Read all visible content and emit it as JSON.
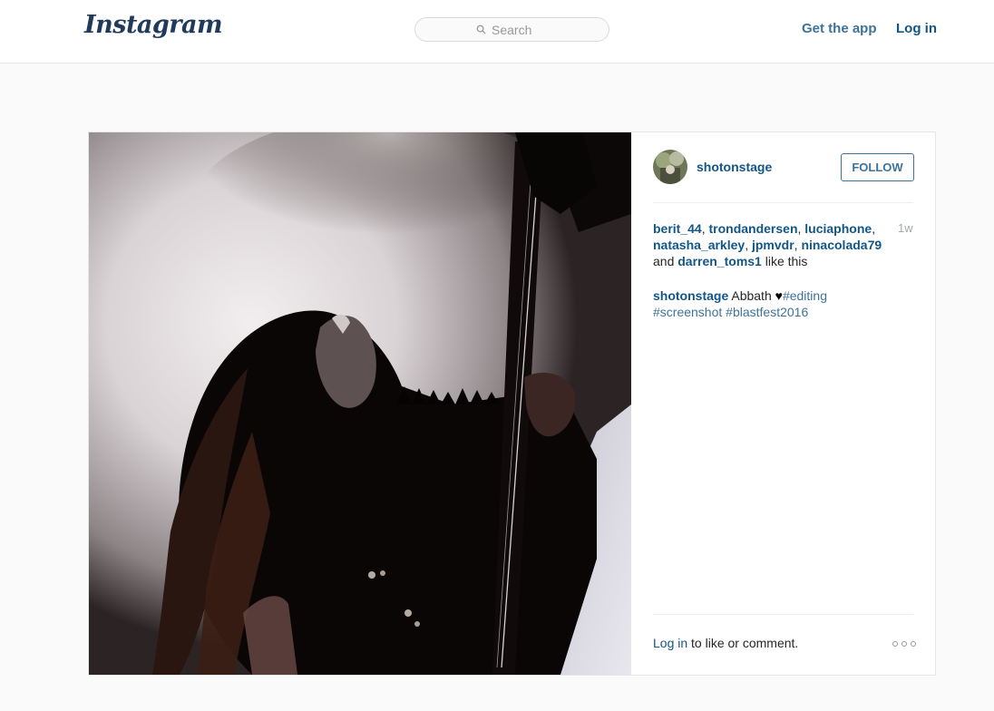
{
  "header": {
    "logo_text": "Instagram",
    "search_placeholder": "Search",
    "get_app_label": "Get the app",
    "login_label": "Log in"
  },
  "post": {
    "username": "shotonstage",
    "follow_label": "FOLLOW",
    "likes": {
      "users": [
        "berit_44",
        "trondandersen",
        "luciaphone",
        "natasha_arkley",
        "jpmvdr",
        "ninacolada79",
        "darren_toms1"
      ],
      "and_text": "and",
      "suffix": "like this"
    },
    "time_ago": "1w",
    "caption": {
      "user": "shotonstage",
      "text": "Abbath",
      "emoji": "♥",
      "hashtags": [
        "#editing",
        "#screenshot",
        "#blastfest2016"
      ]
    },
    "footer": {
      "login_link": "Log in",
      "suffix": " to like or comment."
    },
    "more_icon": "ellipsis-icon"
  },
  "colors": {
    "link_dark": "#125688",
    "link_light": "#3f729b",
    "border": "#e6e6e6",
    "background": "#fafafa"
  }
}
